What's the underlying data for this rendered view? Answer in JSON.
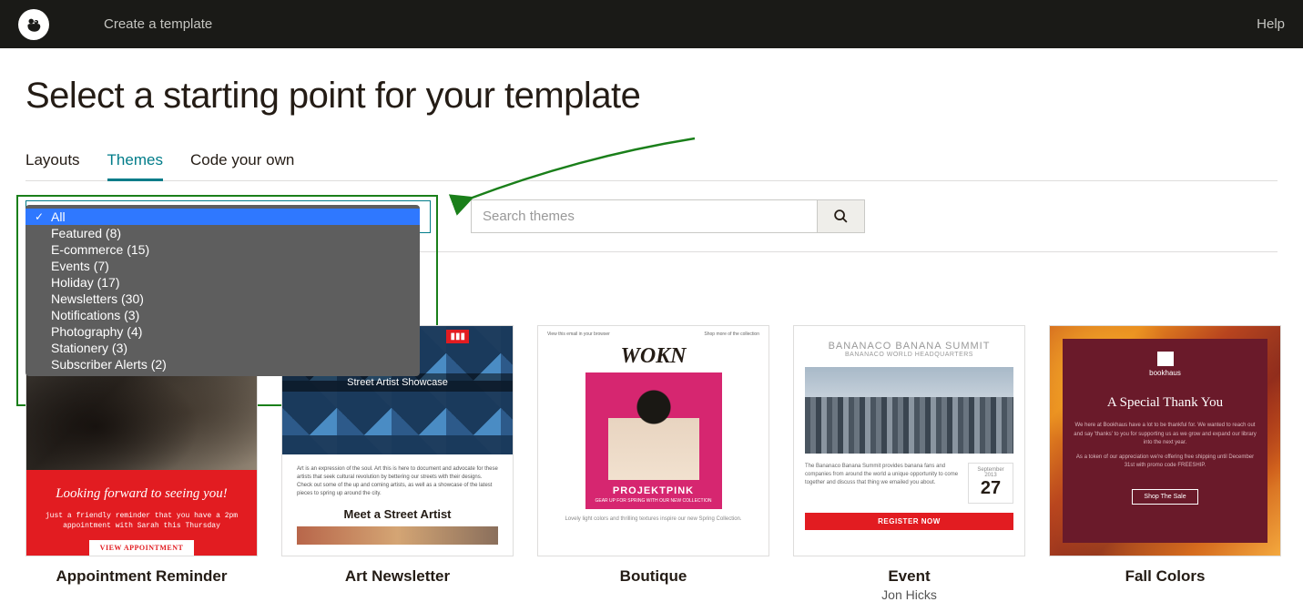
{
  "header": {
    "breadcrumb": "Create a template",
    "help": "Help"
  },
  "page_title": "Select a starting point for your template",
  "tabs": [
    {
      "label": "Layouts",
      "active": false
    },
    {
      "label": "Themes",
      "active": true
    },
    {
      "label": "Code your own",
      "active": false
    }
  ],
  "search": {
    "placeholder": "Search themes"
  },
  "dropdown": {
    "options": [
      "All",
      "Featured (8)",
      "E-commerce (15)",
      "Events (7)",
      "Holiday (17)",
      "Newsletters (30)",
      "Notifications (3)",
      "Photography (4)",
      "Stationery (3)",
      "Subscriber Alerts (2)"
    ],
    "selected_index": 0
  },
  "templates": [
    {
      "title": "Appointment Reminder",
      "subtitle": "",
      "thumb": {
        "headline": "Looking forward to seeing you!",
        "sub": "just a friendly reminder that you have a 2pm\nappointment with Sarah this Thursday",
        "btn": "VIEW APPOINTMENT"
      }
    },
    {
      "title": "Art Newsletter",
      "subtitle": "",
      "thumb": {
        "banner": "Street Artist Showcase",
        "headline": "Meet a Street Artist",
        "body": "Art is an expression of the soul. Art this is here to document and advocate for these artists that seek cultural revolution by bettering our streets with their designs. Check out some of the up and coming artists, as well as a showcase of the latest pieces to spring up around the city."
      }
    },
    {
      "title": "Boutique",
      "subtitle": "",
      "thumb": {
        "logo": "WOKN",
        "band_h": "PROJEKTPINK",
        "band_s": "GEAR UP FOR SPRING WITH OUR NEW COLLECTION",
        "cap": "Lovely light colors and thrilling textures inspire our new Spring Collection."
      }
    },
    {
      "title": "Event",
      "subtitle": "Jon Hicks",
      "thumb": {
        "h": "BANANACO BANANA SUMMIT",
        "s": "BANANACO WORLD HEADQUARTERS",
        "txt": "The Bananaco Banana Summit provides banana fans and companies from around the world a unique opportunity to come together and discuss that thing we emailed you about.",
        "month": "September 2013",
        "day": "27",
        "btn": "REGISTER NOW"
      }
    },
    {
      "title": "Fall Colors",
      "subtitle": "",
      "thumb": {
        "logo": "bookhaus",
        "h": "A Special Thank You",
        "p1": "We here at Bookhaus have a lot to be thankful for. We wanted to reach out and say 'thanks' to you for supporting us as we grow and expand our library into the next year.",
        "p2": "As a token of our appreciation we're offering free shipping until December 31st with promo code FREESHIP.",
        "btn": "Shop The Sale"
      }
    }
  ]
}
